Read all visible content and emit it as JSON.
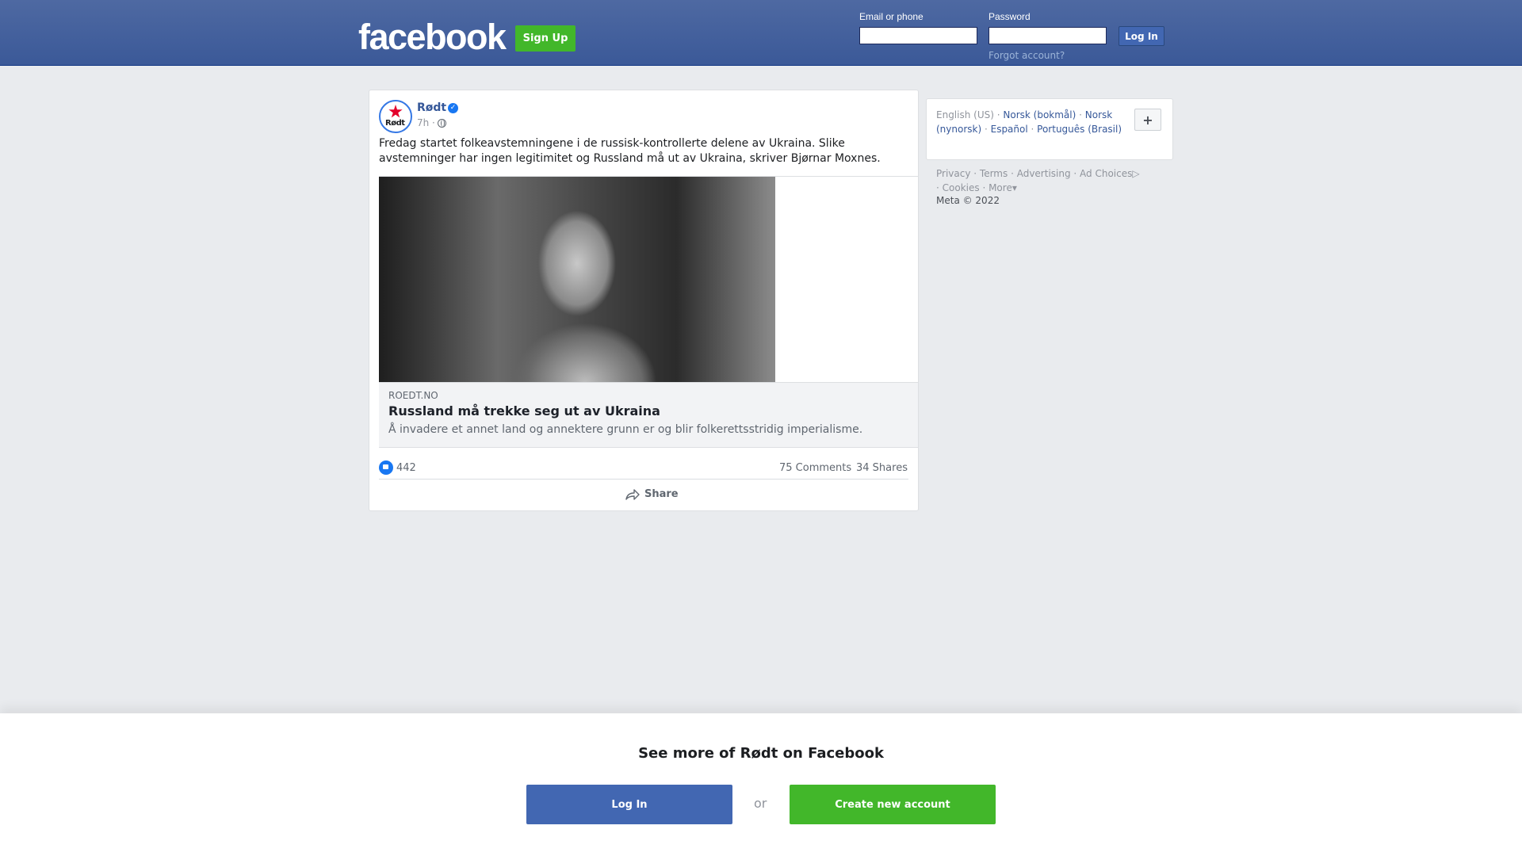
{
  "header": {
    "brand": "facebook",
    "signup_label": "Sign Up",
    "email_label": "Email or phone",
    "password_label": "Password",
    "login_label": "Log In",
    "forgot_label": "Forgot account?"
  },
  "post": {
    "page_name": "Rødt",
    "avatar_text": "Rødt",
    "time": "7h ·",
    "text": "Fredag startet folkeavstemningene i de russisk-kontrollerte delene av Ukraina. Slike avstemninger har ingen legitimitet og Russland må ut av Ukraina, skriver Bjørnar Moxnes.",
    "link": {
      "domain": "ROEDT.NO",
      "title": "Russland må trekke seg ut av Ukraina",
      "description": "Å invadere et annet land og annektere grunn er og blir folkerettsstridig imperialisme."
    },
    "likes": "442",
    "comments": "75 Comments",
    "shares": "34 Shares",
    "share_label": "Share"
  },
  "languages": {
    "current": "English (US)",
    "items": [
      "Norsk (bokmål)",
      "Norsk (nynorsk)",
      "Español",
      "Português (Brasil)"
    ],
    "plus": "+"
  },
  "footer": {
    "links": [
      "Privacy",
      "Terms",
      "Advertising",
      "Ad Choices",
      "Cookies",
      "More"
    ],
    "copyright": "Meta © 2022"
  },
  "bottom": {
    "heading": "See more of Rødt on Facebook",
    "login_label": "Log In",
    "or_label": "or",
    "create_label": "Create new account"
  },
  "colors": {
    "brand_blue": "#3b5998",
    "green": "#42b72a",
    "link": "#365899"
  }
}
